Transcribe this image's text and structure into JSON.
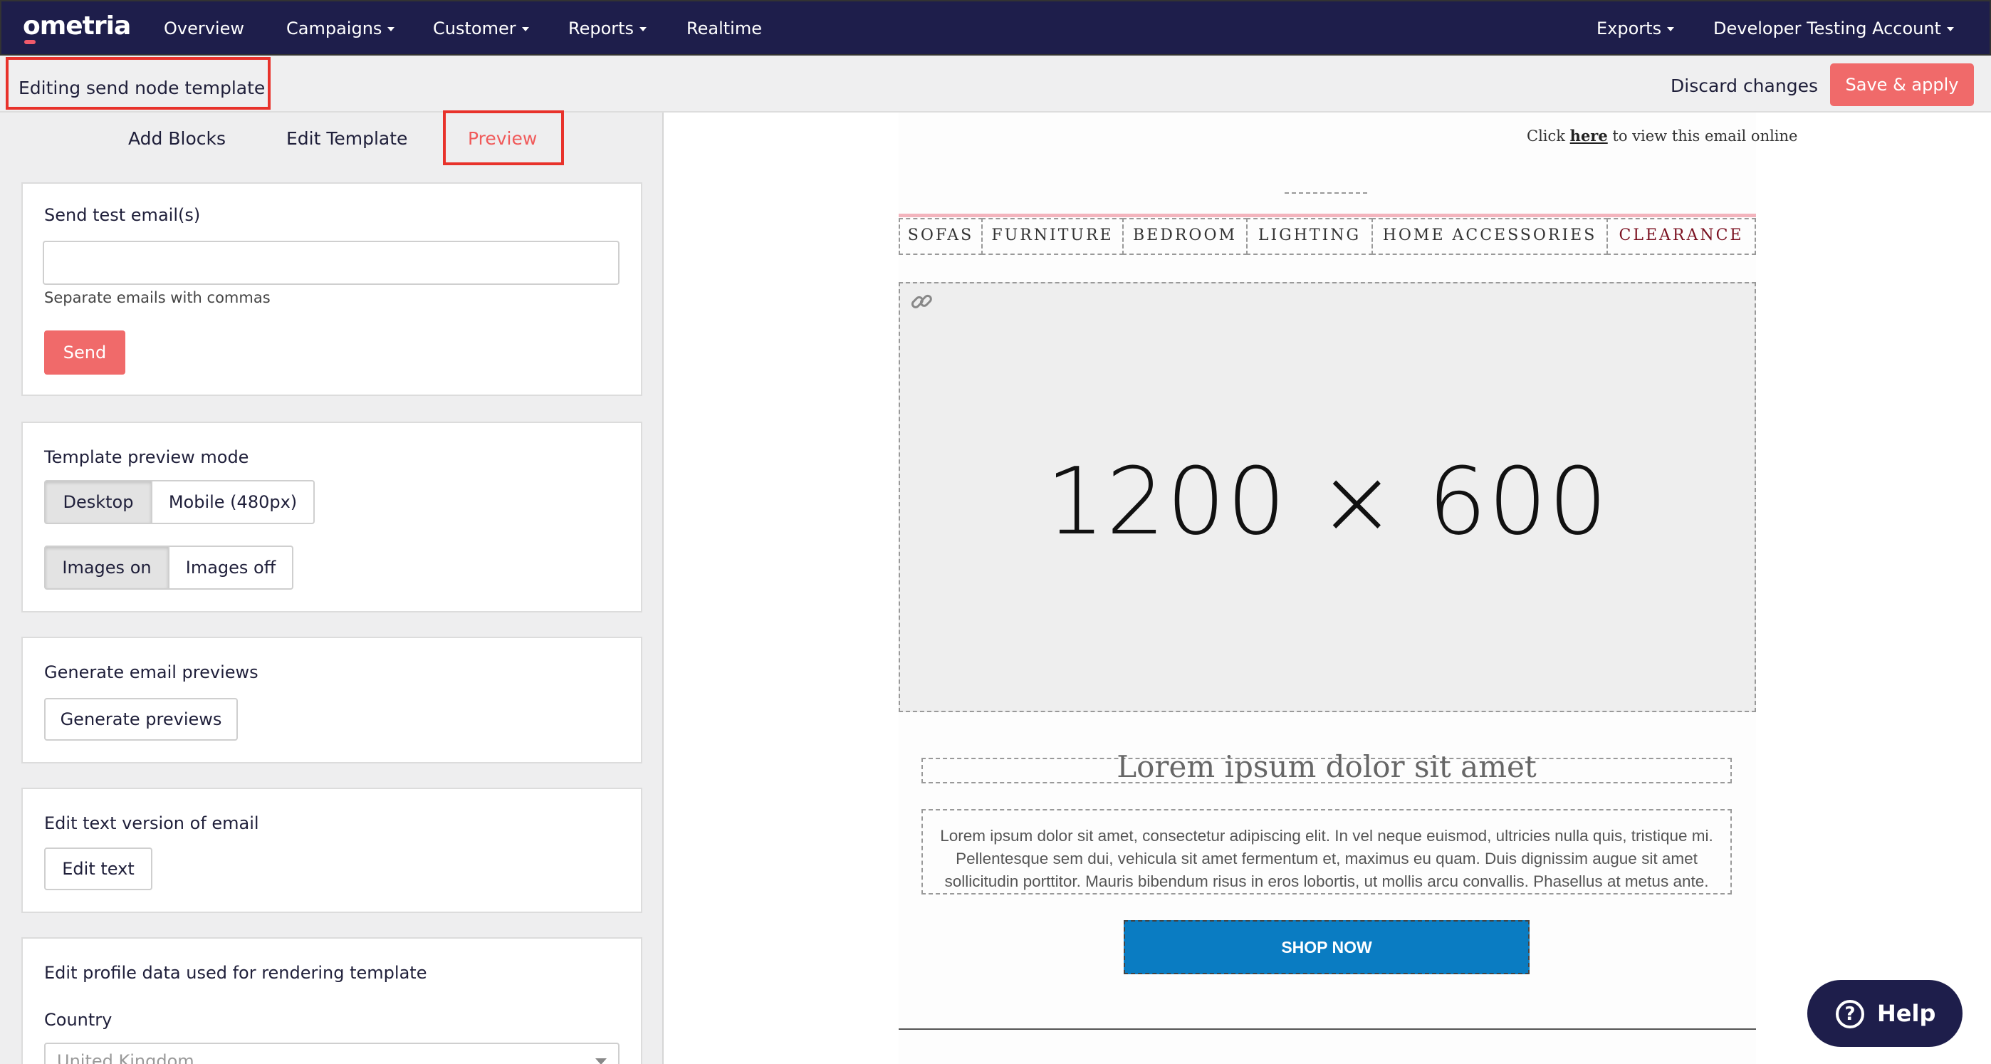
{
  "brand": {
    "logo_text": "ometria"
  },
  "nav": {
    "overview": "Overview",
    "campaigns": "Campaigns",
    "customer": "Customer",
    "reports": "Reports",
    "realtime": "Realtime",
    "exports": "Exports",
    "account": "Developer Testing Account"
  },
  "subheader": {
    "title": "Editing send node template",
    "discard": "Discard changes",
    "save": "Save & apply"
  },
  "tabs": {
    "add_blocks": "Add Blocks",
    "edit_template": "Edit Template",
    "preview": "Preview"
  },
  "send_test": {
    "title": "Send test email(s)",
    "input_value": "",
    "help": "Separate emails with commas",
    "button": "Send"
  },
  "preview_mode": {
    "title": "Template preview mode",
    "desktop": "Desktop",
    "mobile": "Mobile (480px)",
    "images_on": "Images on",
    "images_off": "Images off",
    "selected_mode": "Desktop",
    "selected_images": "Images on"
  },
  "generate": {
    "title": "Generate email previews",
    "button": "Generate previews"
  },
  "text_version": {
    "title": "Edit text version of email",
    "button": "Edit text"
  },
  "profile": {
    "title": "Edit profile data used for rendering template",
    "country_label": "Country",
    "country_value": "United Kingdom"
  },
  "email": {
    "view_online_prefix": "Click ",
    "view_online_link": "here",
    "view_online_suffix": " to view this email online",
    "menu": [
      "SOFAS",
      "FURNITURE",
      "BEDROOM",
      "LIGHTING",
      "HOME ACCESSORIES",
      "CLEARANCE"
    ],
    "hero_placeholder": "1200 × 600",
    "headline": "Lorem ipsum dolor sit amet",
    "body": "Lorem ipsum dolor sit amet, consectetur adipiscing elit. In vel neque euismod, ultricies nulla quis, tristique mi. Pellentesque sem dui, vehicula sit amet fermentum et, maximus eu quam. Duis dignissim augue sit amet sollicitudin porttitor. Mauris bibendum risus in eros lobortis, ut mollis arcu convallis. Phasellus at metus ante.",
    "cta": "SHOP NOW"
  },
  "help": {
    "label": "Help"
  },
  "colors": {
    "nav_bg": "#1e1e4b",
    "accent_red": "#f06a6a",
    "cta_blue": "#0a7cc2",
    "highlight_box": "#e8322b"
  }
}
